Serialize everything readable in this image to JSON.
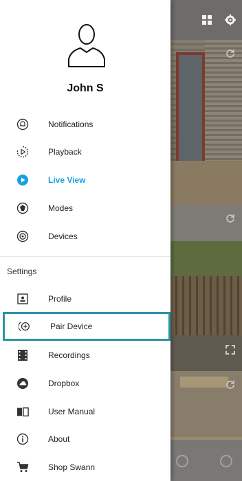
{
  "user": {
    "name": "John S"
  },
  "menu": {
    "items": [
      {
        "label": "Notifications",
        "icon": "bell-icon"
      },
      {
        "label": "Playback",
        "icon": "play-outline-icon"
      },
      {
        "label": "Live View",
        "icon": "live-play-icon",
        "active": true
      },
      {
        "label": "Modes",
        "icon": "modes-icon"
      },
      {
        "label": "Devices",
        "icon": "devices-icon"
      }
    ],
    "settings_label": "Settings",
    "settings_items": [
      {
        "label": "Profile",
        "icon": "profile-icon"
      },
      {
        "label": "Pair Device",
        "icon": "pair-device-icon",
        "highlighted": true
      },
      {
        "label": "Recordings",
        "icon": "recordings-icon"
      },
      {
        "label": "Dropbox",
        "icon": "dropbox-icon"
      },
      {
        "label": "User Manual",
        "icon": "book-icon"
      },
      {
        "label": "About",
        "icon": "info-icon"
      },
      {
        "label": "Shop Swann",
        "icon": "cart-icon"
      }
    ]
  },
  "colors": {
    "accent": "#1aa0e0",
    "highlight_border": "#2a94a8"
  }
}
